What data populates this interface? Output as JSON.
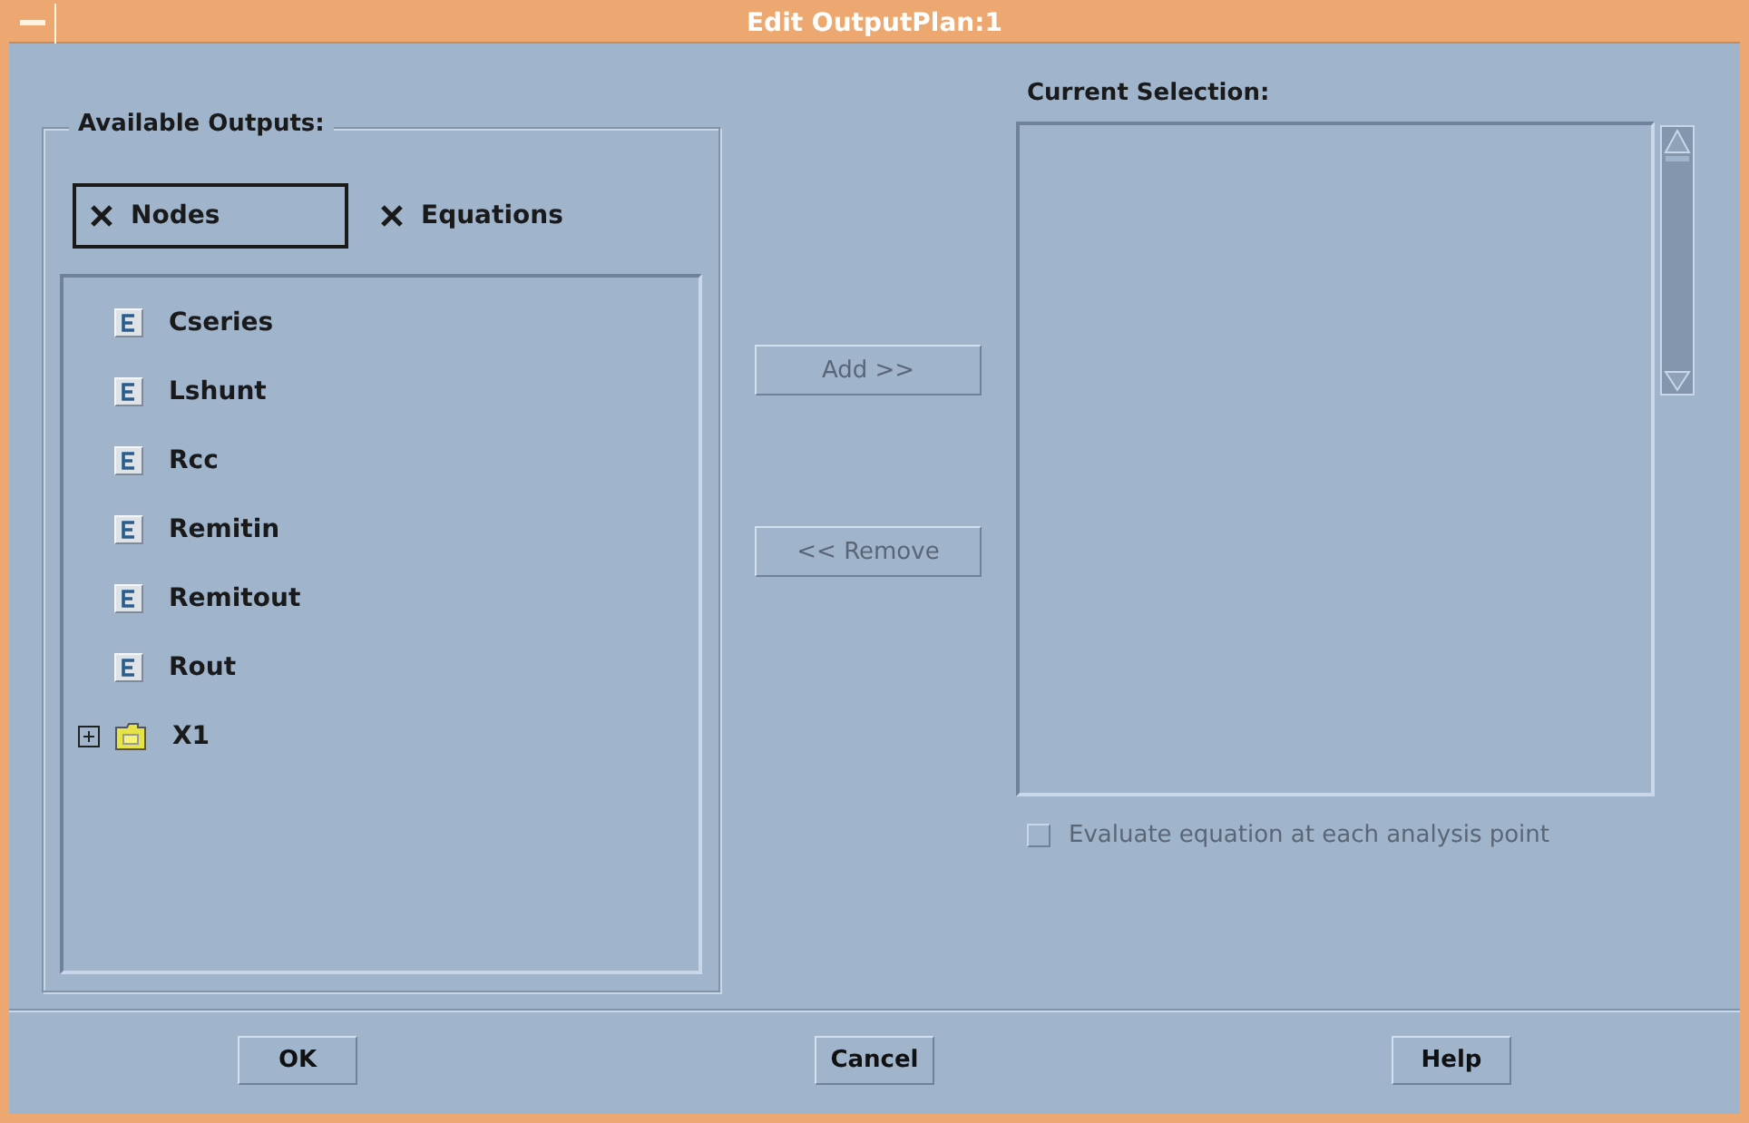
{
  "window": {
    "title": "Edit OutputPlan:1"
  },
  "available_outputs": {
    "label": "Available Outputs:",
    "filters": [
      {
        "label": "Nodes",
        "checked": true,
        "focused": true
      },
      {
        "label": "Equations",
        "checked": true,
        "focused": false
      }
    ],
    "items": [
      {
        "kind": "equation",
        "label": "Cseries"
      },
      {
        "kind": "equation",
        "label": "Lshunt"
      },
      {
        "kind": "equation",
        "label": "Rcc"
      },
      {
        "kind": "equation",
        "label": "Remitin"
      },
      {
        "kind": "equation",
        "label": "Remitout"
      },
      {
        "kind": "equation",
        "label": "Rout"
      },
      {
        "kind": "folder",
        "label": "X1",
        "expanded": false
      }
    ]
  },
  "transfer_buttons": [
    {
      "label": "Add >>",
      "disabled": true
    },
    {
      "label": "<< Remove",
      "disabled": true
    }
  ],
  "current_selection": {
    "label": "Current Selection:"
  },
  "evaluate_option": {
    "label": "Evaluate equation at each analysis point",
    "checked": false,
    "disabled": true
  },
  "buttons": [
    {
      "label": "OK"
    },
    {
      "label": "Cancel"
    },
    {
      "label": "Help"
    }
  ]
}
